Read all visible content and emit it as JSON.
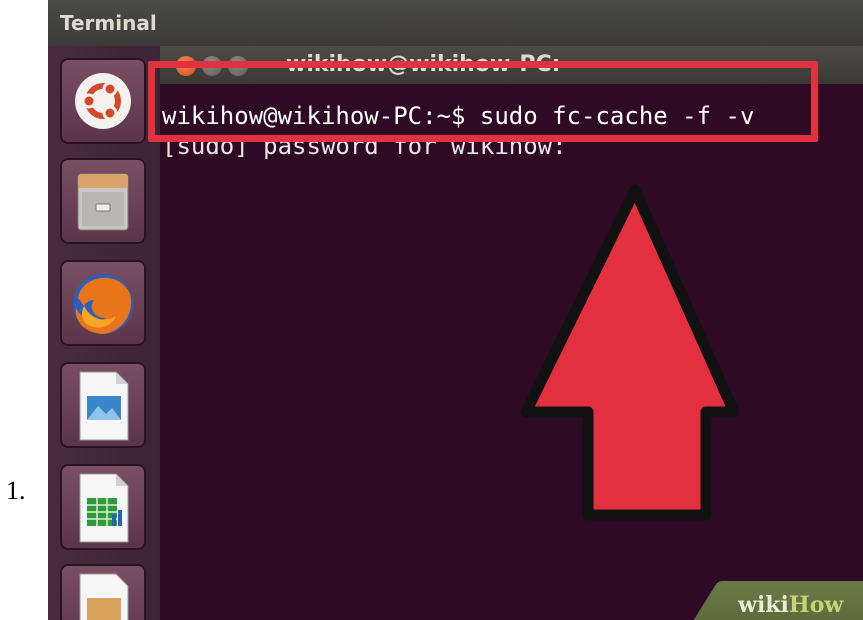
{
  "step": {
    "number": "1."
  },
  "topbar": {
    "title": "Terminal"
  },
  "launcher": {
    "items": [
      {
        "name": "ubuntu-dash",
        "icon": "ubuntu-logo-icon"
      },
      {
        "name": "files",
        "icon": "file-cabinet-icon"
      },
      {
        "name": "firefox",
        "icon": "firefox-icon"
      },
      {
        "name": "libreoffice-impress",
        "icon": "presentation-icon"
      },
      {
        "name": "libreoffice-calc",
        "icon": "spreadsheet-icon"
      },
      {
        "name": "libreoffice-impress-2",
        "icon": "document-chart-icon"
      }
    ]
  },
  "terminal": {
    "window_title": "wikihow@wikihow-PC: ~",
    "lines": [
      "wikihow@wikihow-PC:~$ sudo fc-cache -f -v",
      "[sudo] password for wikihow:"
    ]
  },
  "annotation": {
    "highlight_color": "#e2323f",
    "arrow_color": "#e33040"
  },
  "watermark": {
    "wiki": "wiki",
    "how": "How"
  }
}
